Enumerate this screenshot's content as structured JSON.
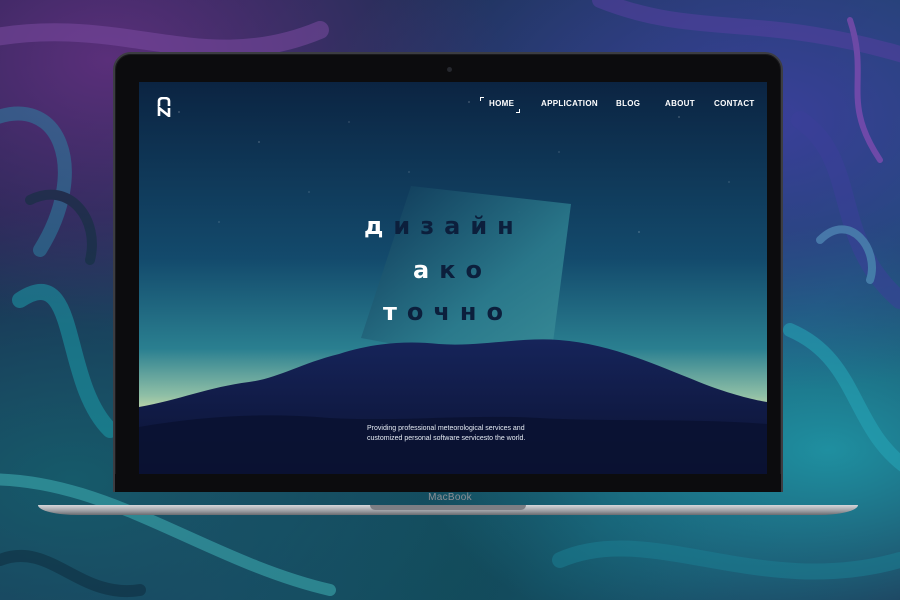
{
  "site": {
    "logo_icon": "stacked-n-monogram"
  },
  "nav": {
    "items": [
      {
        "label": "HOME",
        "active": true
      },
      {
        "label": "APPLICATION",
        "active": false
      },
      {
        "label": "BLOG",
        "active": false
      },
      {
        "label": "ABOUT",
        "active": false
      },
      {
        "label": "CONTACT",
        "active": false
      }
    ]
  },
  "hero": {
    "lines": [
      {
        "first": "д",
        "rest": "изайн"
      },
      {
        "first": "а",
        "rest": "ко"
      },
      {
        "first": "т",
        "rest": "очно"
      }
    ],
    "tagline_1": "Providing professional meteorological services and",
    "tagline_2": "customized personal software servicesto the world."
  },
  "device": {
    "brand_label": "MacBook"
  },
  "colors": {
    "accent_text": "#ffffff",
    "headline_dark": "#0c1f3c",
    "sky_top": "#0a2440",
    "horizon_glow": "#d8e0a0"
  }
}
